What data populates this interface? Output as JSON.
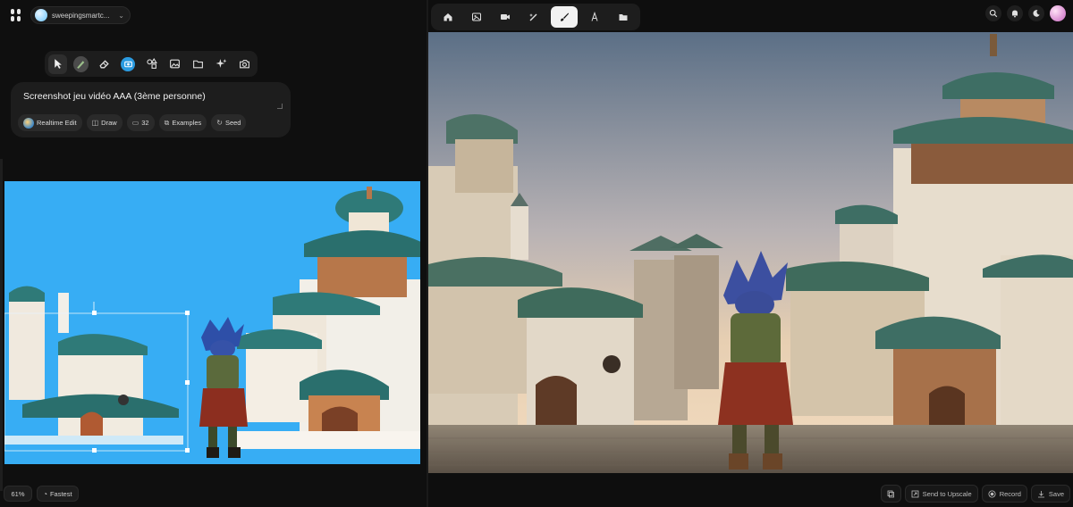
{
  "account": {
    "name": "sweepingsmartc..."
  },
  "left_toolbar": {
    "tools": [
      {
        "name": "cursor-icon",
        "active": true
      },
      {
        "name": "brush-icon"
      },
      {
        "name": "eraser-icon"
      },
      {
        "name": "camera-badge-icon"
      },
      {
        "name": "shapes-icon"
      },
      {
        "name": "image-icon"
      },
      {
        "name": "folder-icon"
      },
      {
        "name": "sparkles-icon"
      },
      {
        "name": "camera-plus-icon"
      }
    ]
  },
  "prompt": {
    "text": "Screenshot jeu vidéo AAA (3ème personne)",
    "chips": {
      "realtime": "Realtime Edit",
      "draw": "Draw",
      "count": "32",
      "examples": "Examples",
      "seed": "Seed"
    }
  },
  "footer_left": {
    "zoom": "61%",
    "speed": "Fastest"
  },
  "right_toolbar": {
    "tools": [
      {
        "name": "home-icon"
      },
      {
        "name": "image-icon"
      },
      {
        "name": "video-icon"
      },
      {
        "name": "magic-wand-icon"
      },
      {
        "name": "brush-icon",
        "active": true
      },
      {
        "name": "text-icon"
      },
      {
        "name": "folder-icon"
      }
    ]
  },
  "top_right_icons": [
    "search-icon",
    "bell-icon",
    "moon-icon",
    "user-avatar"
  ],
  "footer_right": {
    "copy": "",
    "upscale": "Send to Upscale",
    "record": "Record",
    "save": "Save"
  },
  "colors": {
    "canvas_bg": "#37adf4",
    "accent_active": "#f2f2f2"
  }
}
